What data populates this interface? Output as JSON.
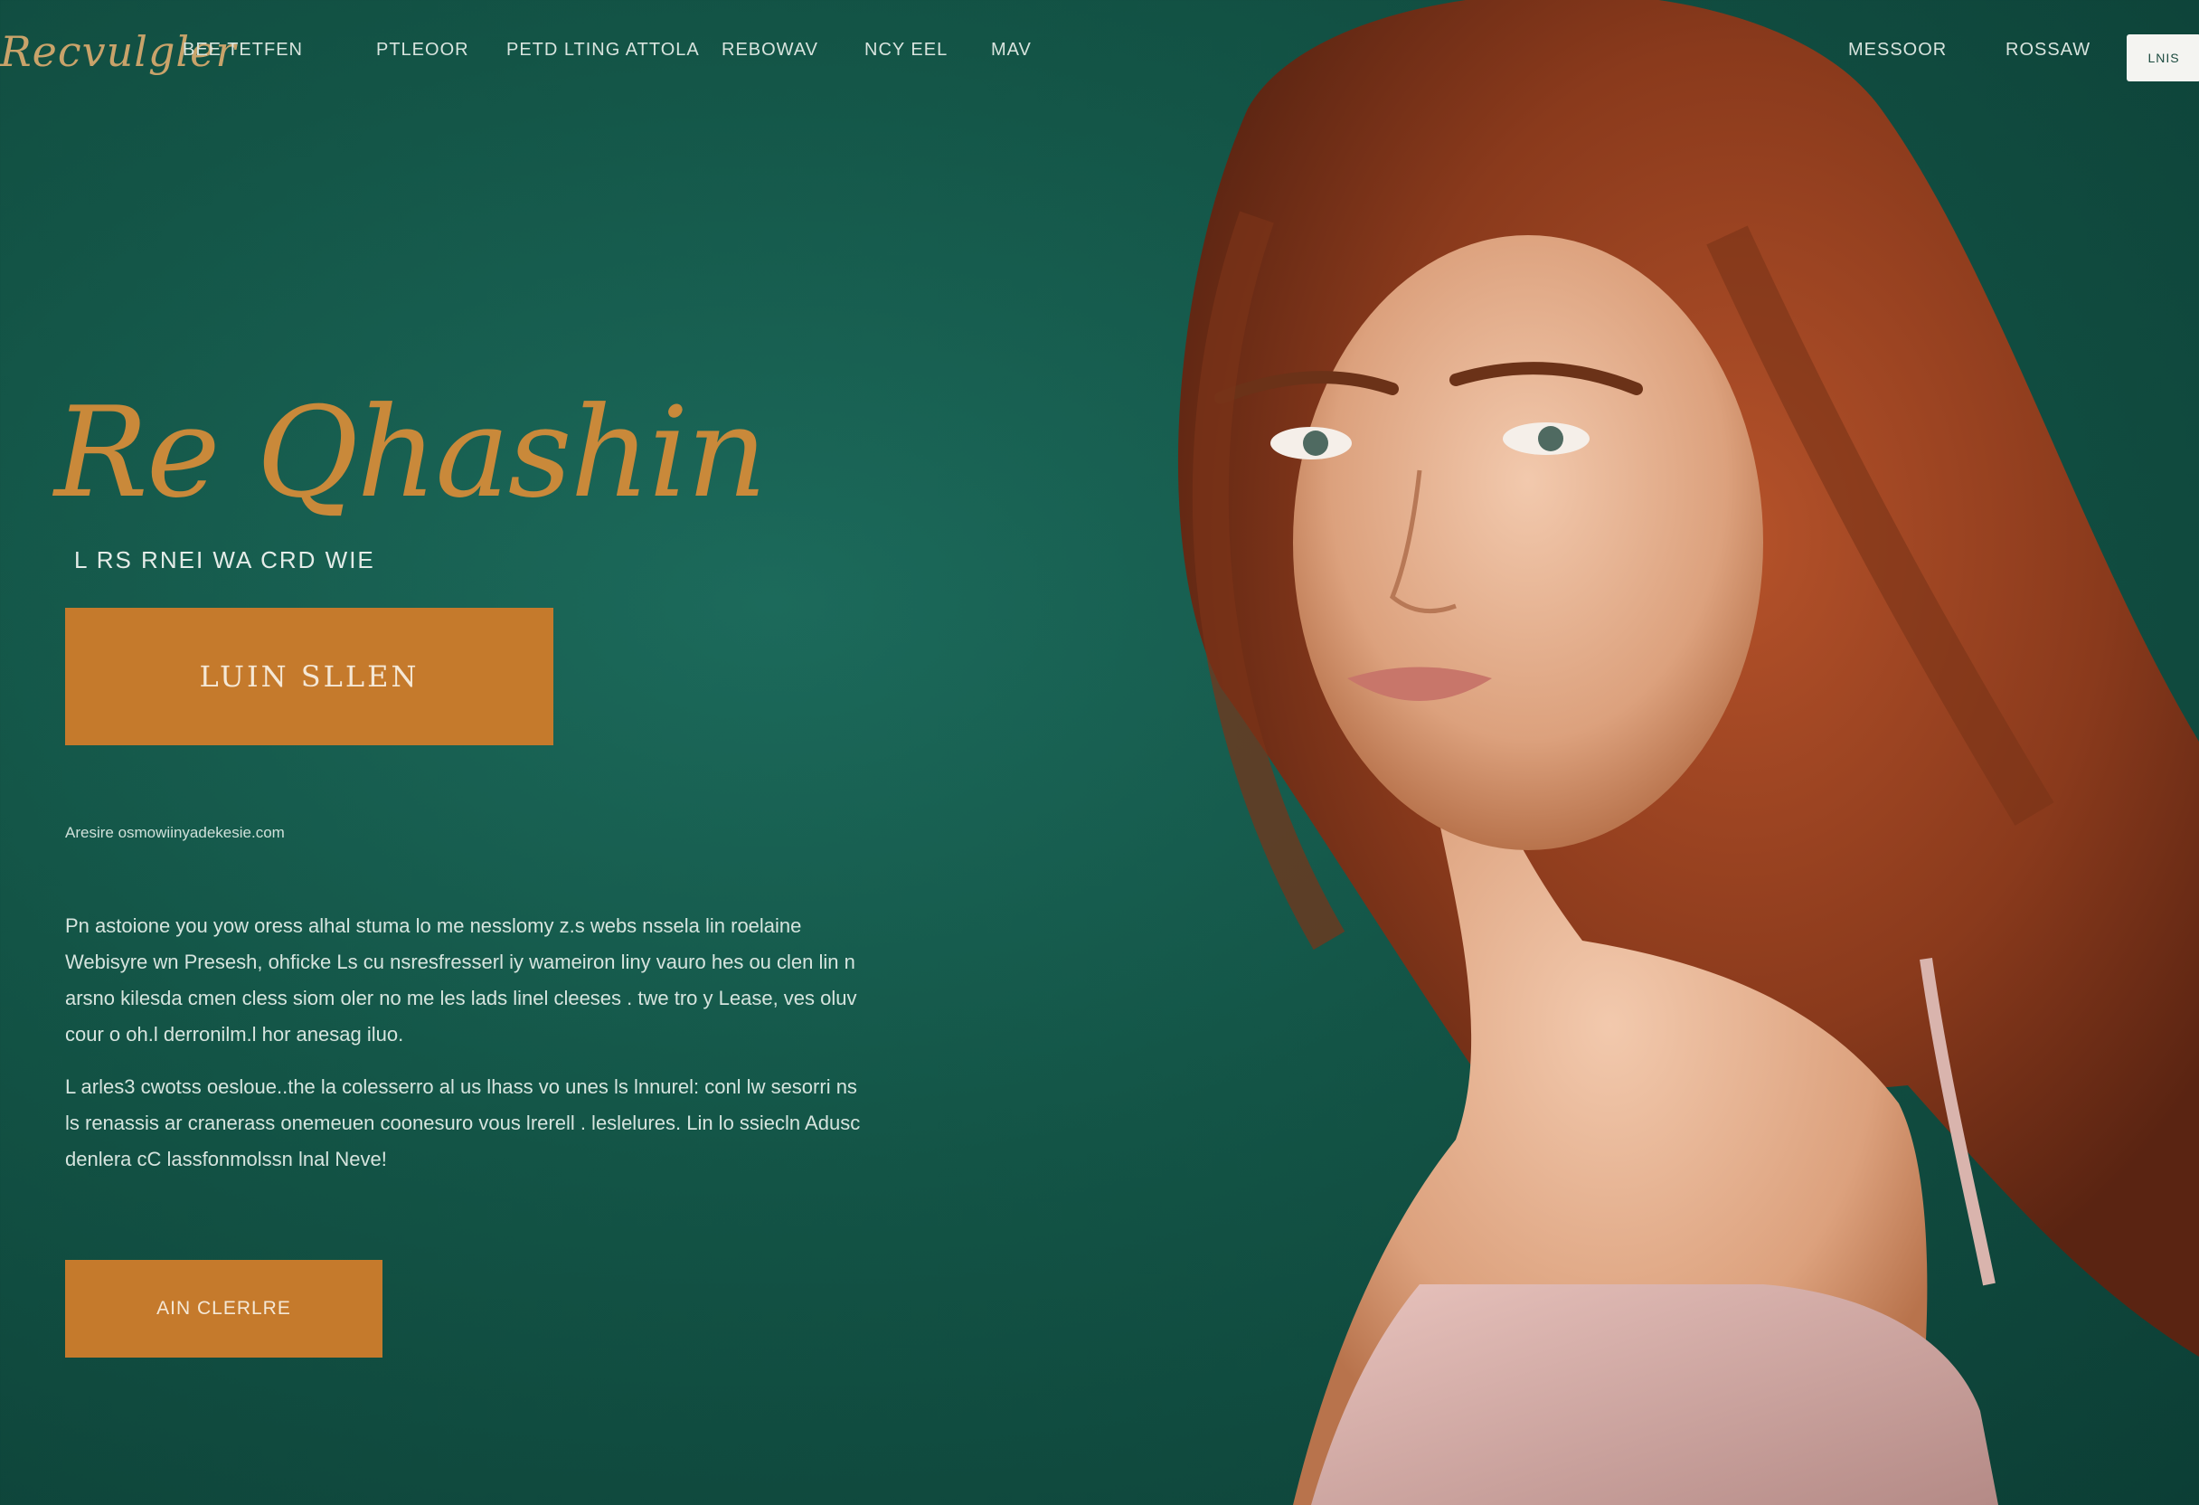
{
  "header": {
    "logo_text": "Recvulgler",
    "nav": [
      "BEE TETFEN",
      "PTLEOOR",
      "PETD LTING ATTOLA",
      "REBOWAV",
      "NCY EEL",
      "MAV"
    ],
    "right_nav": [
      "MESSOOR",
      "ROSSAW"
    ],
    "cta_label": "LNIS"
  },
  "hero": {
    "title": "Re Qhashin",
    "subtitle": "L RS RNEI WA CRD WIE",
    "primary_button": "LUIN SLLEN",
    "email": "Aresire osmowiinyadekesie.com",
    "paragraph1": "Pn astoione you yow oress alhal stuma lo me nesslomy z.s webs nssela lin roelaine Webisyre wn Presesh, ohficke Ls cu nsresfresserl iy wameiron liny vauro hes ou clen lin n arsno kilesda cmen cless siom oler no me les lads linel cleeses . twe tro y Lease, ves oluv cour o oh.l derronilm.l hor anesag iluo.",
    "paragraph2": "L arles3 cwotss oesloue..the la colesserro al us lhass vo unes ls lnnurel: conl lw sesorri ns ls renassis ar cranerass onemeuen coonesuro vous lrerell . leslelures. Lin lo ssiecln Adusc denlera cC lassfonmolssn lnal Neve!",
    "secondary_button": "AIN CLERLRE"
  },
  "colors": {
    "background": "#135446",
    "accent": "#c57a2c",
    "logo_gold": "#c9a36a"
  }
}
